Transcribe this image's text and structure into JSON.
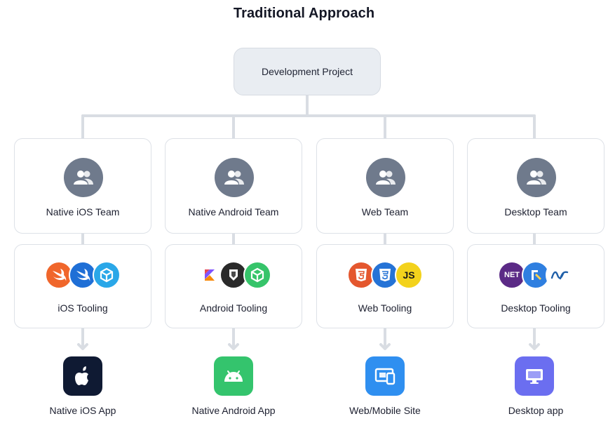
{
  "title": "Traditional Approach",
  "root": {
    "label": "Development Project"
  },
  "columns": [
    {
      "team": "Native iOS Team",
      "tooling": "iOS Tooling",
      "tools": [
        {
          "name": "swift-logo-icon",
          "color": "#f0662b"
        },
        {
          "name": "swift-logo-alt-icon",
          "color": "#1f6fd6"
        },
        {
          "name": "xcode-cube-icon",
          "color": "#2aa7e8"
        }
      ],
      "app": "Native iOS App",
      "app_color": "#0f1a33"
    },
    {
      "team": "Native Android Team",
      "tooling": "Android Tooling",
      "tools": [
        {
          "name": "kotlin-logo-icon",
          "color": "#ffffff"
        },
        {
          "name": "android-studio-icon",
          "color": "#2a2a2a"
        },
        {
          "name": "android-cube-icon",
          "color": "#36c46a"
        }
      ],
      "app": "Native Android App",
      "app_color": "#34c46d"
    },
    {
      "team": "Web Team",
      "tooling": "Web Tooling",
      "tools": [
        {
          "name": "html5-logo-icon",
          "color": "#e4572e"
        },
        {
          "name": "css3-logo-icon",
          "color": "#2573d6"
        },
        {
          "name": "js-logo-icon",
          "color": "#f3d21c",
          "text": "JS"
        }
      ],
      "app": "Web/Mobile Site",
      "app_color": "#2f8ff0"
    },
    {
      "team": "Desktop Team",
      "tooling": "Desktop Tooling",
      "tools": [
        {
          "name": "dotnet-logo-icon",
          "color": "#5b2a86",
          "text": "NET"
        },
        {
          "name": "xcode-hammer-icon",
          "color": "#2f7fe0"
        },
        {
          "name": "electron-logo-icon",
          "color": "#ffffff"
        }
      ],
      "app": "Desktop app",
      "app_color": "#6b6ef0"
    }
  ],
  "colors": {
    "connector": "#d9dde3",
    "team_icon_bg": "#6f7a8c",
    "root_bg": "#e9edf2"
  }
}
